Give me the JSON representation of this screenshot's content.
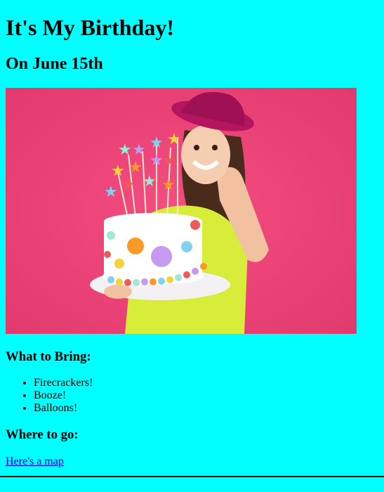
{
  "page": {
    "title": "It's My Birthday!",
    "date": "On June 15th",
    "image_alt": "Girl holding a birthday cake with star toppers, wearing a pink party hat",
    "bring": {
      "heading": "What to Bring:",
      "items": [
        "Firecrackers!",
        "Booze!",
        "Balloons!"
      ]
    },
    "where": {
      "heading": "Where to go:",
      "link_text": "Here's a map"
    }
  },
  "colors": {
    "background": "#00ffff",
    "photo_backdrop": "#f0457a",
    "link": "#0000ee"
  }
}
